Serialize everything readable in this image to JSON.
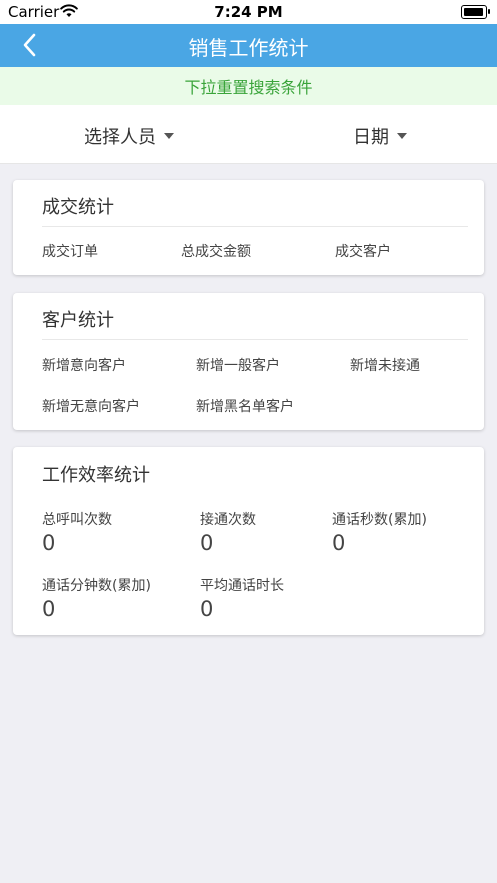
{
  "status_bar": {
    "carrier": "Carrier",
    "time": "7:24 PM"
  },
  "nav": {
    "title": "销售工作统计",
    "back_icon": "chevron-left-icon"
  },
  "tip": {
    "text": "下拉重置搜索条件"
  },
  "filters": {
    "person_label": "选择人员",
    "date_label": "日期"
  },
  "deal_stats": {
    "title": "成交统计",
    "items": [
      "成交订单",
      "总成交金额",
      "成交客户"
    ]
  },
  "customer_stats": {
    "title": "客户统计",
    "items": [
      "新增意向客户",
      "新增一般客户",
      "新增未接通",
      "新增无意向客户",
      "新增黑名单客户"
    ]
  },
  "efficiency_stats": {
    "title": "工作效率统计",
    "items": [
      {
        "label": "总呼叫次数",
        "value": "0"
      },
      {
        "label": "接通次数",
        "value": "0"
      },
      {
        "label": "通话秒数(累加)",
        "value": "0"
      },
      {
        "label": "通话分钟数(累加)",
        "value": "0"
      },
      {
        "label": "平均通话时长",
        "value": "0"
      }
    ]
  },
  "colors": {
    "nav": "#4aa6e4",
    "tip_bg": "#eafbe8",
    "tip_text": "#3aa43a",
    "page_bg": "#efeff4"
  }
}
